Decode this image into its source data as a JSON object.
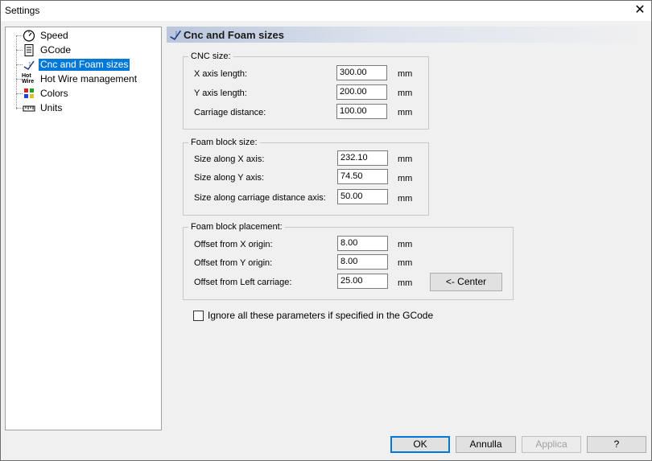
{
  "window": {
    "title": "Settings",
    "close_glyph": "✕"
  },
  "tree": {
    "items": [
      {
        "label": "Speed",
        "icon": "gauge-icon"
      },
      {
        "label": "GCode",
        "icon": "document-icon"
      },
      {
        "label": "Cnc and Foam sizes",
        "icon": "cnc-icon",
        "selected": true
      },
      {
        "label": "Hot Wire management",
        "icon": "hot-wire-icon",
        "icon_text": "Hot Wire"
      },
      {
        "label": "Colors",
        "icon": "palette-icon"
      },
      {
        "label": "Units",
        "icon": "ruler-icon"
      }
    ]
  },
  "page": {
    "title": "Cnc and Foam sizes"
  },
  "cnc_size": {
    "title": "CNC size:",
    "rows": [
      {
        "label": "X axis length:",
        "value": "300.00",
        "unit": "mm"
      },
      {
        "label": "Y axis length:",
        "value": "200.00",
        "unit": "mm"
      },
      {
        "label": "Carriage distance:",
        "value": "100.00",
        "unit": "mm"
      }
    ]
  },
  "foam_size": {
    "title": "Foam block size:",
    "rows": [
      {
        "label": "Size along X axis:",
        "value": "232.10",
        "unit": "mm"
      },
      {
        "label": "Size along Y axis:",
        "value": "74.50",
        "unit": "mm"
      },
      {
        "label": "Size along carriage distance axis:",
        "value": "50.00",
        "unit": "mm"
      }
    ]
  },
  "foam_placement": {
    "title": "Foam block placement:",
    "rows": [
      {
        "label": "Offset from X origin:",
        "value": "8.00",
        "unit": "mm"
      },
      {
        "label": "Offset from Y origin:",
        "value": "8.00",
        "unit": "mm"
      },
      {
        "label": "Offset from Left carriage:",
        "value": "25.00",
        "unit": "mm"
      }
    ],
    "center_button": "<- Center"
  },
  "ignore_checkbox": {
    "label": "Ignore all these parameters if specified in the GCode",
    "checked": false
  },
  "buttons": {
    "ok": "OK",
    "cancel": "Annulla",
    "apply": "Applica",
    "help": "?"
  },
  "colors": {
    "selection": "#0078d7",
    "header_gradient_start": "#b9c6dc"
  }
}
